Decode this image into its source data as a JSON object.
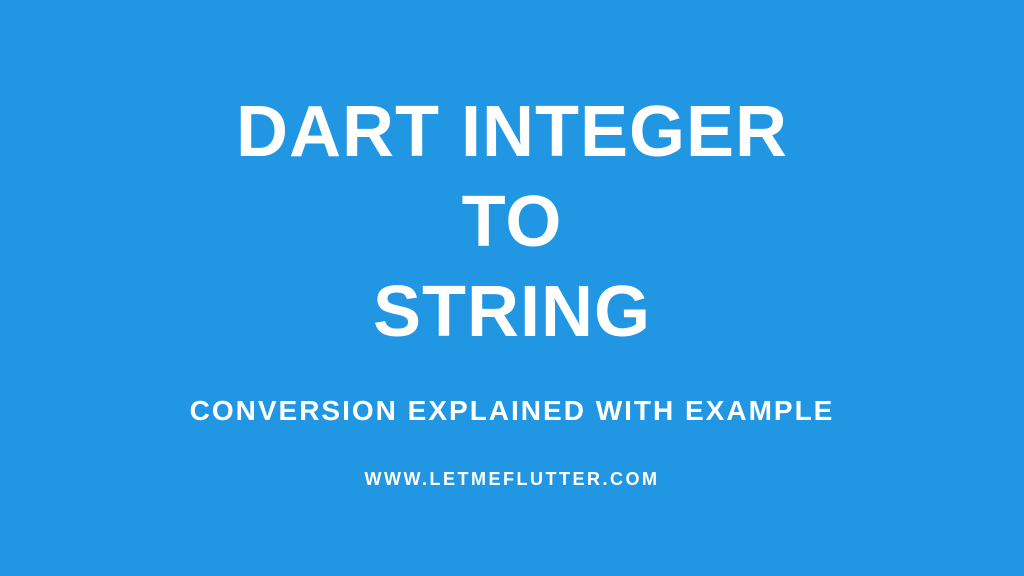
{
  "title": {
    "line1": "DART INTEGER",
    "line2": "TO",
    "line3": "STRING"
  },
  "subtitle": "CONVERSION EXPLAINED WITH EXAMPLE",
  "website": "WWW.LETMEFLUTTER.COM"
}
